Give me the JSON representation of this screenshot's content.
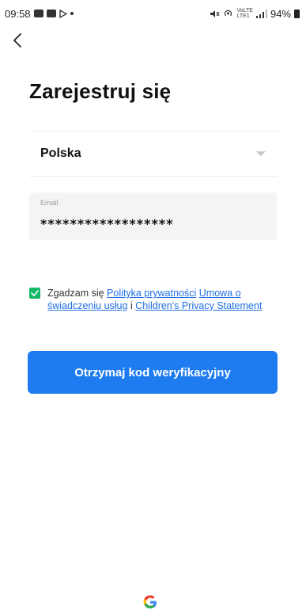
{
  "status_bar": {
    "time": "09:58",
    "battery": "94%",
    "network_label_top": "VoLTE",
    "network_label_bottom": "LTE1"
  },
  "header": {
    "back_icon": "chevron-left-icon",
    "title": "Zarejestruj się"
  },
  "form": {
    "country": {
      "value": "Polska",
      "icon": "caret-down-icon"
    },
    "email": {
      "label": "Email",
      "value": "******************"
    }
  },
  "consent": {
    "checked": true,
    "prefix": "Zgadzam się",
    "privacy_policy": "Polityka prywatności",
    "service_agreement": "Umowa o świadczeniu usług",
    "conjunction": "i",
    "children_privacy": "Children's Privacy Statement"
  },
  "actions": {
    "submit_label": "Otrzymaj kod weryfikacyjny"
  },
  "footer": {
    "icon": "google-g-icon"
  },
  "colors": {
    "accent": "#1f7cf0",
    "link": "#1f6fe5",
    "checkbox": "#12b76a"
  }
}
